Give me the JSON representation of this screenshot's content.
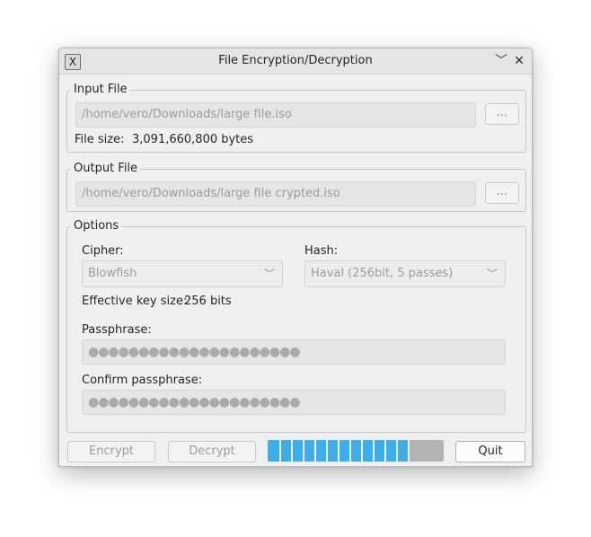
{
  "window": {
    "title": "File Encryption/Decryption",
    "app_icon": "X",
    "minimize_glyph": "﹀",
    "close_glyph": "✕"
  },
  "input_file": {
    "group_title": "Input File",
    "path": "/home/vero/Downloads/large file.iso",
    "browse_label": "...",
    "size_label": "File size:",
    "size_value": "3,091,660,800 bytes"
  },
  "output_file": {
    "group_title": "Output File",
    "path": "/home/vero/Downloads/large file crypted.iso",
    "browse_label": "..."
  },
  "options": {
    "group_title": "Options",
    "cipher_label": "Cipher:",
    "cipher_value": "Blowfish",
    "hash_label": "Hash:",
    "hash_value": "Haval (256bit, 5 passes)",
    "key_size_label": "Effective key size:",
    "key_size_value": "256 bits",
    "passphrase_label": "Passphrase:",
    "passphrase_mask": "●●●●●●●●●●●●●●●●●●●●●",
    "confirm_label": "Confirm passphrase:",
    "confirm_mask": "●●●●●●●●●●●●●●●●●●●●●"
  },
  "buttons": {
    "encrypt": "Encrypt",
    "decrypt": "Decrypt",
    "quit": "Quit"
  },
  "progress": {
    "fraction": 0.8,
    "color": "#3daee9"
  }
}
